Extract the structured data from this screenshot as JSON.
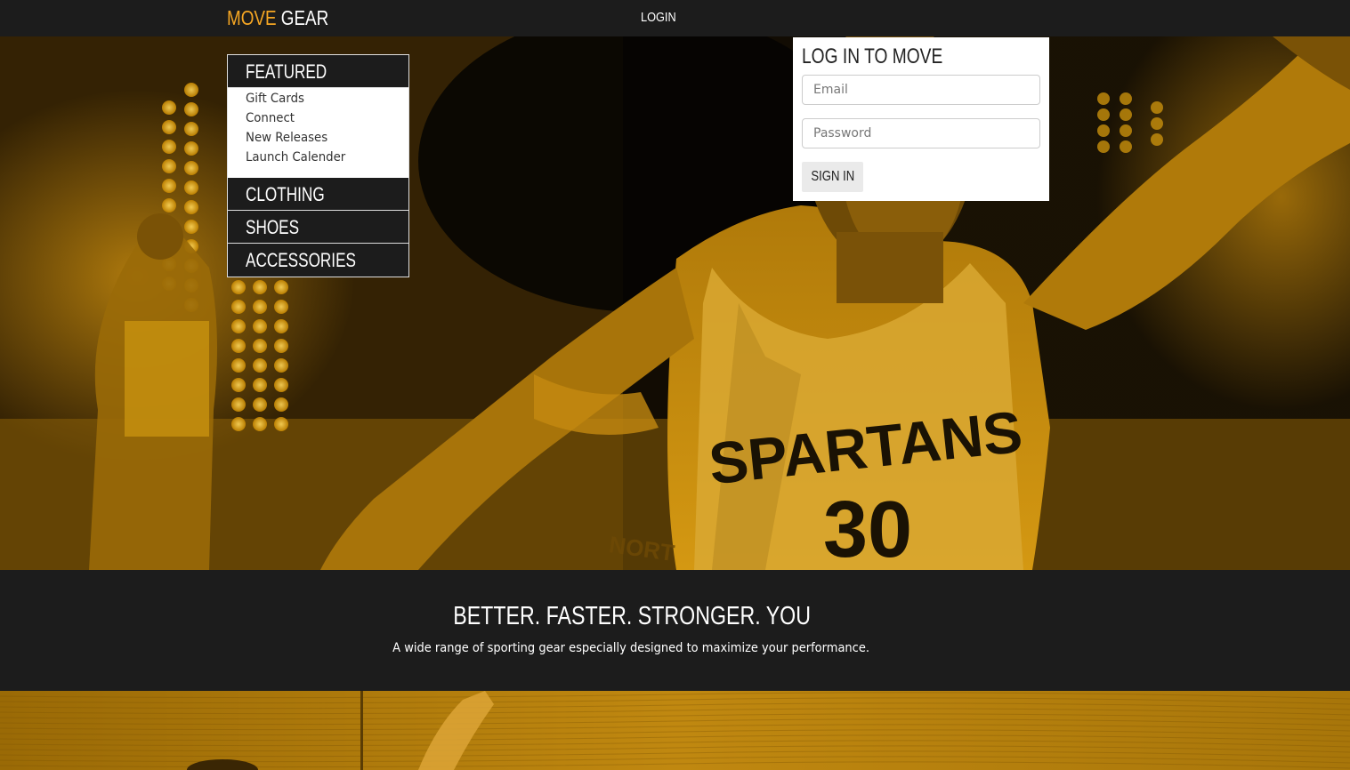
{
  "header": {
    "brand_part1": "MOVE",
    "brand_part2": "GEAR",
    "login_link": "LOGIN"
  },
  "menu": {
    "featured": {
      "label": "FEATURED",
      "items": [
        "Gift Cards",
        "Connect",
        "New Releases",
        "Launch Calender"
      ]
    },
    "clothing": "CLOTHING",
    "shoes": "SHOES",
    "accessories": "ACCESSORIES"
  },
  "login_panel": {
    "title": "LOG IN TO MOVE",
    "email_placeholder": "Email",
    "password_placeholder": "Password",
    "signin_label": "SIGN IN"
  },
  "tagline": {
    "title": "BETTER. FASTER. STRONGER. YOU",
    "subtitle": "A wide range of sporting gear especially designed to maximize your performance."
  },
  "hero_jersey": {
    "team_text": "SPARTANS",
    "number": "30",
    "bg_jersey_text": "NORTH CAROLINA"
  },
  "colors": {
    "accent": "#f5a623",
    "dark": "#1c1c1c",
    "hero_tint": "#c88a0a"
  },
  "icons": {
    "hero": "basketball-player-photo",
    "strip": "wood-court-photo"
  }
}
